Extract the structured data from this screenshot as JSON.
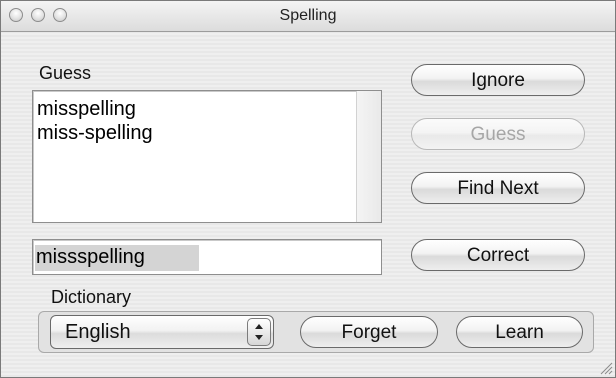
{
  "window": {
    "title": "Spelling"
  },
  "guess_section": {
    "label": "Guess",
    "suggestions": [
      "misspelling",
      "miss-spelling"
    ]
  },
  "word_field": {
    "value": "missspelling"
  },
  "buttons": {
    "ignore": "Ignore",
    "guess": "Guess",
    "find_next": "Find Next",
    "correct": "Correct",
    "forget": "Forget",
    "learn": "Learn"
  },
  "dictionary": {
    "label": "Dictionary",
    "selected": "English"
  },
  "icons": {
    "window_controls": [
      "close-icon",
      "minimize-icon",
      "zoom-icon"
    ],
    "select_arrows": "up-down-arrows-icon",
    "resize": "resize-grip-icon"
  }
}
